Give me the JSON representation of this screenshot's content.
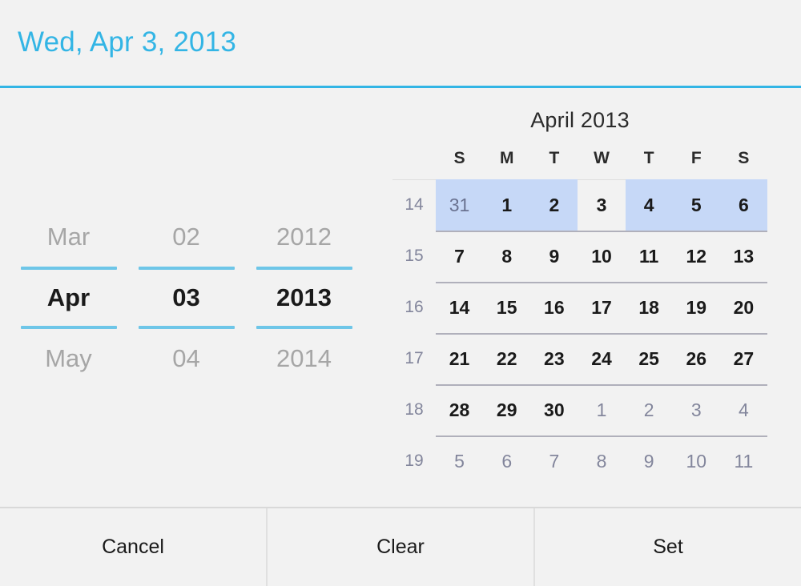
{
  "header": {
    "selected_date_label": "Wed, Apr 3, 2013",
    "accent_color": "#33b5e5"
  },
  "spinners": [
    {
      "name": "month",
      "previous": "Mar",
      "selected": "Apr",
      "next": "May"
    },
    {
      "name": "day",
      "previous": "02",
      "selected": "03",
      "next": "04"
    },
    {
      "name": "year",
      "previous": "2012",
      "selected": "2013",
      "next": "2014"
    }
  ],
  "calendar": {
    "title": "April 2013",
    "weekday_headers": [
      "S",
      "M",
      "T",
      "W",
      "T",
      "F",
      "S"
    ],
    "highlight_color": "#c6d8f7",
    "weeks": [
      {
        "week_number": "14",
        "days": [
          {
            "label": "31",
            "adjacent": true,
            "highlighted": true
          },
          {
            "label": "1",
            "adjacent": false,
            "highlighted": true
          },
          {
            "label": "2",
            "adjacent": false,
            "highlighted": true
          },
          {
            "label": "3",
            "adjacent": false,
            "highlighted": false
          },
          {
            "label": "4",
            "adjacent": false,
            "highlighted": true
          },
          {
            "label": "5",
            "adjacent": false,
            "highlighted": true
          },
          {
            "label": "6",
            "adjacent": false,
            "highlighted": true
          }
        ]
      },
      {
        "week_number": "15",
        "days": [
          {
            "label": "7",
            "adjacent": false,
            "highlighted": false
          },
          {
            "label": "8",
            "adjacent": false,
            "highlighted": false
          },
          {
            "label": "9",
            "adjacent": false,
            "highlighted": false
          },
          {
            "label": "10",
            "adjacent": false,
            "highlighted": false
          },
          {
            "label": "11",
            "adjacent": false,
            "highlighted": false
          },
          {
            "label": "12",
            "adjacent": false,
            "highlighted": false
          },
          {
            "label": "13",
            "adjacent": false,
            "highlighted": false
          }
        ]
      },
      {
        "week_number": "16",
        "days": [
          {
            "label": "14",
            "adjacent": false,
            "highlighted": false
          },
          {
            "label": "15",
            "adjacent": false,
            "highlighted": false
          },
          {
            "label": "16",
            "adjacent": false,
            "highlighted": false
          },
          {
            "label": "17",
            "adjacent": false,
            "highlighted": false
          },
          {
            "label": "18",
            "adjacent": false,
            "highlighted": false
          },
          {
            "label": "19",
            "adjacent": false,
            "highlighted": false
          },
          {
            "label": "20",
            "adjacent": false,
            "highlighted": false
          }
        ]
      },
      {
        "week_number": "17",
        "days": [
          {
            "label": "21",
            "adjacent": false,
            "highlighted": false
          },
          {
            "label": "22",
            "adjacent": false,
            "highlighted": false
          },
          {
            "label": "23",
            "adjacent": false,
            "highlighted": false
          },
          {
            "label": "24",
            "adjacent": false,
            "highlighted": false
          },
          {
            "label": "25",
            "adjacent": false,
            "highlighted": false
          },
          {
            "label": "26",
            "adjacent": false,
            "highlighted": false
          },
          {
            "label": "27",
            "adjacent": false,
            "highlighted": false
          }
        ]
      },
      {
        "week_number": "18",
        "days": [
          {
            "label": "28",
            "adjacent": false,
            "highlighted": false
          },
          {
            "label": "29",
            "adjacent": false,
            "highlighted": false
          },
          {
            "label": "30",
            "adjacent": false,
            "highlighted": false
          },
          {
            "label": "1",
            "adjacent": true,
            "highlighted": false
          },
          {
            "label": "2",
            "adjacent": true,
            "highlighted": false
          },
          {
            "label": "3",
            "adjacent": true,
            "highlighted": false
          },
          {
            "label": "4",
            "adjacent": true,
            "highlighted": false
          }
        ]
      },
      {
        "week_number": "19",
        "days": [
          {
            "label": "5",
            "adjacent": true,
            "highlighted": false
          },
          {
            "label": "6",
            "adjacent": true,
            "highlighted": false
          },
          {
            "label": "7",
            "adjacent": true,
            "highlighted": false
          },
          {
            "label": "8",
            "adjacent": true,
            "highlighted": false
          },
          {
            "label": "9",
            "adjacent": true,
            "highlighted": false
          },
          {
            "label": "10",
            "adjacent": true,
            "highlighted": false
          },
          {
            "label": "11",
            "adjacent": true,
            "highlighted": false
          }
        ]
      }
    ]
  },
  "footer": {
    "buttons": [
      {
        "name": "cancel",
        "label": "Cancel"
      },
      {
        "name": "clear",
        "label": "Clear"
      },
      {
        "name": "set",
        "label": "Set"
      }
    ]
  }
}
